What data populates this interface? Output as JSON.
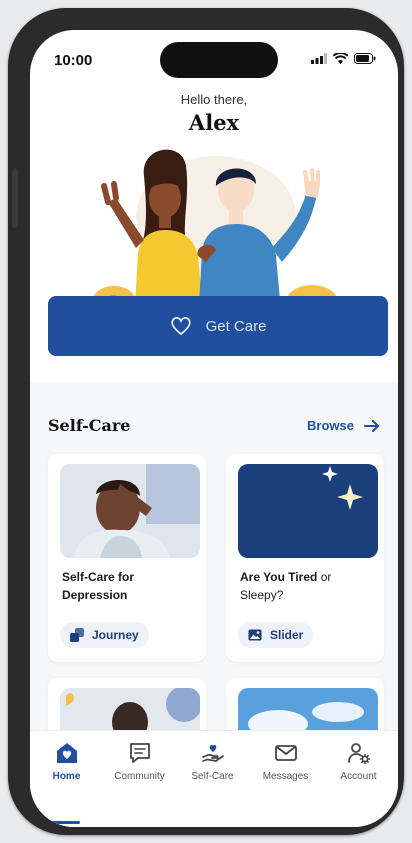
{
  "status_bar": {
    "time": "10:00"
  },
  "header": {
    "greeting": "Hello there,",
    "username": "Alex"
  },
  "get_care": {
    "label": "Get Care"
  },
  "section": {
    "title": "Self-Care",
    "browse_label": "Browse"
  },
  "cards": [
    {
      "title": "Self-Care for Depression",
      "tag": "Journey",
      "tag_icon": "journey-icon"
    },
    {
      "title_main": "Are You Tired",
      "title_light": " or Sleepy?",
      "tag": "Slider",
      "tag_icon": "image-icon"
    }
  ],
  "tabs": [
    {
      "label": "Home",
      "icon": "home-icon",
      "active": true
    },
    {
      "label": "Community",
      "icon": "chat-icon",
      "active": false
    },
    {
      "label": "Self-Care",
      "icon": "hand-heart-icon",
      "active": false
    },
    {
      "label": "Messages",
      "icon": "envelope-icon",
      "active": false
    },
    {
      "label": "Account",
      "icon": "user-gear-icon",
      "active": false
    }
  ],
  "colors": {
    "primary": "#1f4f9d",
    "background": "#f6f7f9",
    "night": "#1b3f7b"
  }
}
